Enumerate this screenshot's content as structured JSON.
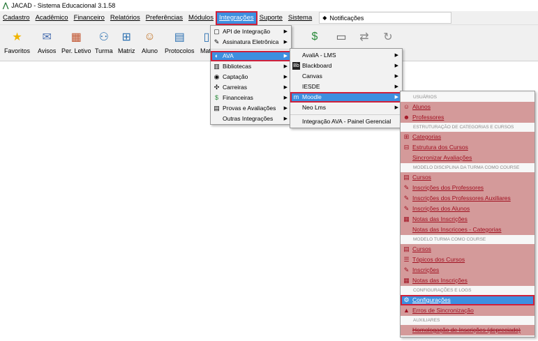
{
  "window": {
    "title": "JACAD - Sistema Educacional 3.1.58"
  },
  "menubar": {
    "items": [
      "Cadastro",
      "Acadêmico",
      "Financeiro",
      "Relatórios",
      "Preferências",
      "Módulos",
      "Integrações",
      "Suporte",
      "Sistema"
    ],
    "notifications": "Notificações"
  },
  "toolbar": {
    "items": [
      {
        "label": "Favoritos",
        "icon": "star-icon"
      },
      {
        "label": "Avisos",
        "icon": "mail-icon"
      },
      {
        "label": "Per. Letivo",
        "icon": "calendar-icon"
      },
      {
        "label": "Turma",
        "icon": "group-icon"
      },
      {
        "label": "Matriz",
        "icon": "org-chart-icon"
      },
      {
        "label": "Aluno",
        "icon": "student-icon"
      },
      {
        "label": "Protocolos",
        "icon": "protocol-icon"
      },
      {
        "label": "Matr",
        "icon": "document-icon"
      }
    ]
  },
  "integracoes_menu": [
    {
      "label": "API de Integração",
      "icon": "api-icon"
    },
    {
      "label": "Assinatura Eletrônica",
      "icon": "signature-icon"
    },
    {
      "label": "AVA",
      "icon": "ava-icon"
    },
    {
      "label": "Bibliotecas",
      "icon": "library-icon"
    },
    {
      "label": "Captação",
      "icon": "capture-icon"
    },
    {
      "label": "Carreiras",
      "icon": "career-icon"
    },
    {
      "label": "Financeiras",
      "icon": "finance-icon"
    },
    {
      "label": "Provas e Avaliações",
      "icon": "exam-icon"
    },
    {
      "label": "Outras Integrações",
      "icon": ""
    }
  ],
  "ava_menu": [
    {
      "label": "AvaliA - LMS",
      "icon": ""
    },
    {
      "label": "Blackboard",
      "icon": "blackboard-icon"
    },
    {
      "label": "Canvas",
      "icon": ""
    },
    {
      "label": "IESDE",
      "icon": ""
    },
    {
      "label": "Moodle",
      "icon": "moodle-icon"
    },
    {
      "label": "Neo Lms",
      "icon": ""
    },
    {
      "label": "Integração AVA - Painel Gerencial",
      "icon": ""
    }
  ],
  "moodle_menu": {
    "headers": [
      "USUÁRIOS",
      "ESTRUTURAÇÃO DE CATEGORIAS E CURSOS",
      "MODELO DISCIPLINA DA TURMA COMO COURSE",
      "MODELO TURMA COMO COURSE",
      "CONFIGURAÇÕES E LOGS",
      "AUXILIARES"
    ],
    "usuarios": [
      "Alunos",
      "Professores"
    ],
    "estrutura": [
      "Categorias",
      "Estrutura dos Cursos",
      "Sincronizar Avaliações"
    ],
    "disciplina": [
      "Cursos",
      "Inscrições dos Professores",
      "Inscrições dos Professores Auxiliares",
      "Inscrições dos Alunos",
      "Notas das Inscrições",
      "Notas das Inscricoes - Categorias"
    ],
    "turma": [
      "Cursos",
      "Tópicos dos Cursos",
      "Inscrições",
      "Notas das Inscrições"
    ],
    "config": [
      "Configurações",
      "Erros de Sincronização"
    ],
    "auxiliares": [
      "Homologação de Inscrições (depreciado)"
    ]
  }
}
